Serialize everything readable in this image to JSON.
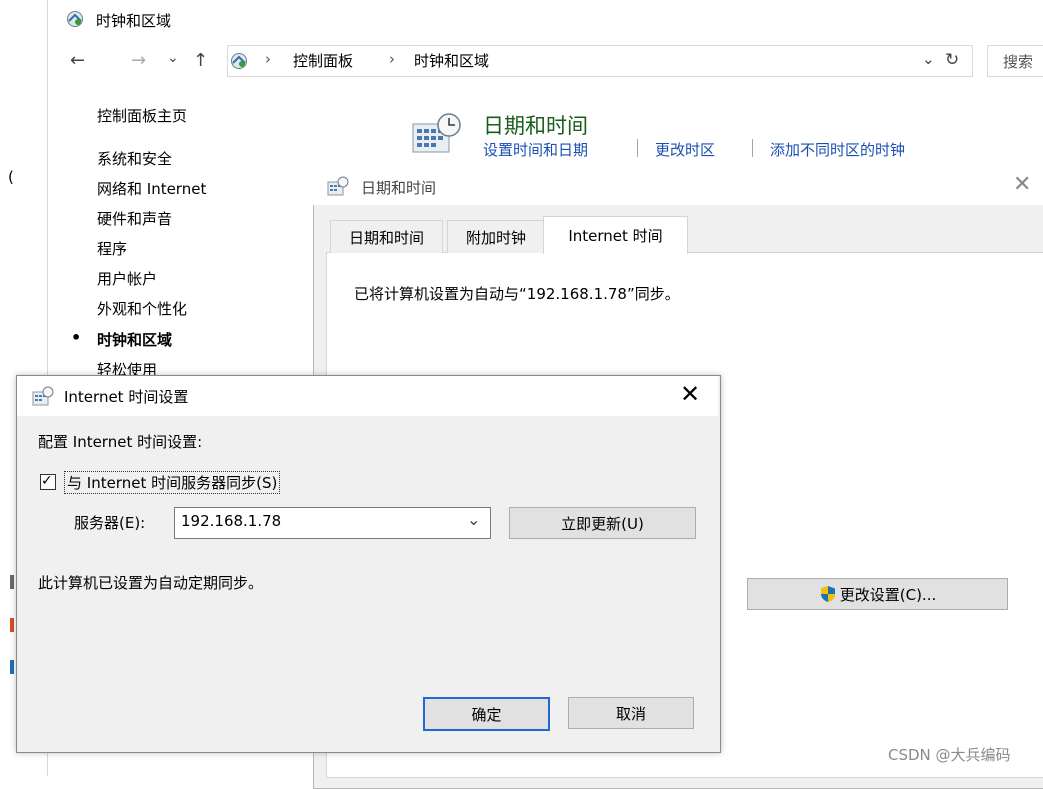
{
  "window": {
    "title": "时钟和区域",
    "nav": {
      "back": "←",
      "forward": "→",
      "recent": "⌄",
      "up": "↑"
    },
    "breadcrumb": [
      "控制面板",
      "时钟和区域"
    ],
    "breadcrumb_sep": "›",
    "address_dropdown": "⌄",
    "refresh": "↻",
    "search_placeholder": "搜索"
  },
  "left_nav": {
    "items": [
      {
        "label": "控制面板主页",
        "selected": false
      },
      {
        "label": "系统和安全",
        "selected": false
      },
      {
        "label": "网络和 Internet",
        "selected": false
      },
      {
        "label": "硬件和声音",
        "selected": false
      },
      {
        "label": "程序",
        "selected": false
      },
      {
        "label": "用户帐户",
        "selected": false
      },
      {
        "label": "外观和个性化",
        "selected": false
      },
      {
        "label": "时钟和区域",
        "selected": true
      },
      {
        "label": "轻松使用",
        "selected": false
      }
    ],
    "bullet": "•"
  },
  "category": {
    "title": "日期和时间",
    "links": [
      "设置时间和日期",
      "更改时区",
      "添加不同时区的时钟"
    ]
  },
  "datetime_dialog": {
    "title": "日期和时间",
    "close": "✕",
    "tabs": [
      {
        "label": "日期和时间",
        "active": false
      },
      {
        "label": "附加时钟",
        "active": false
      },
      {
        "label": "Internet 时间",
        "active": true
      }
    ],
    "sync_status": "已将计算机设置为自动与“192.168.1.78”同步。",
    "change_button": "更改设置(C)..."
  },
  "internet_time_dialog": {
    "title": "Internet 时间设置",
    "close": "✕",
    "config_label": "配置 Internet 时间设置:",
    "sync_checkbox": {
      "label": "与 Internet 时间服务器同步(S)",
      "checked": true,
      "check_mark": "✓"
    },
    "server_label": "服务器(E):",
    "server_value": "192.168.1.78",
    "dropdown_arrow": "⌄",
    "update_button": "立即更新(U)",
    "status": "此计算机已设置为自动定期同步。",
    "ok_button": "确定",
    "cancel_button": "取消"
  },
  "background_fragment": "(",
  "watermark": "CSDN @大兵编码",
  "colors": {
    "link": "#1a4fb3",
    "category_title": "#1a5c1a",
    "focus_border": "#1e6ad2",
    "shield_blue": "#1f6fb5",
    "shield_yellow": "#f2c200"
  }
}
